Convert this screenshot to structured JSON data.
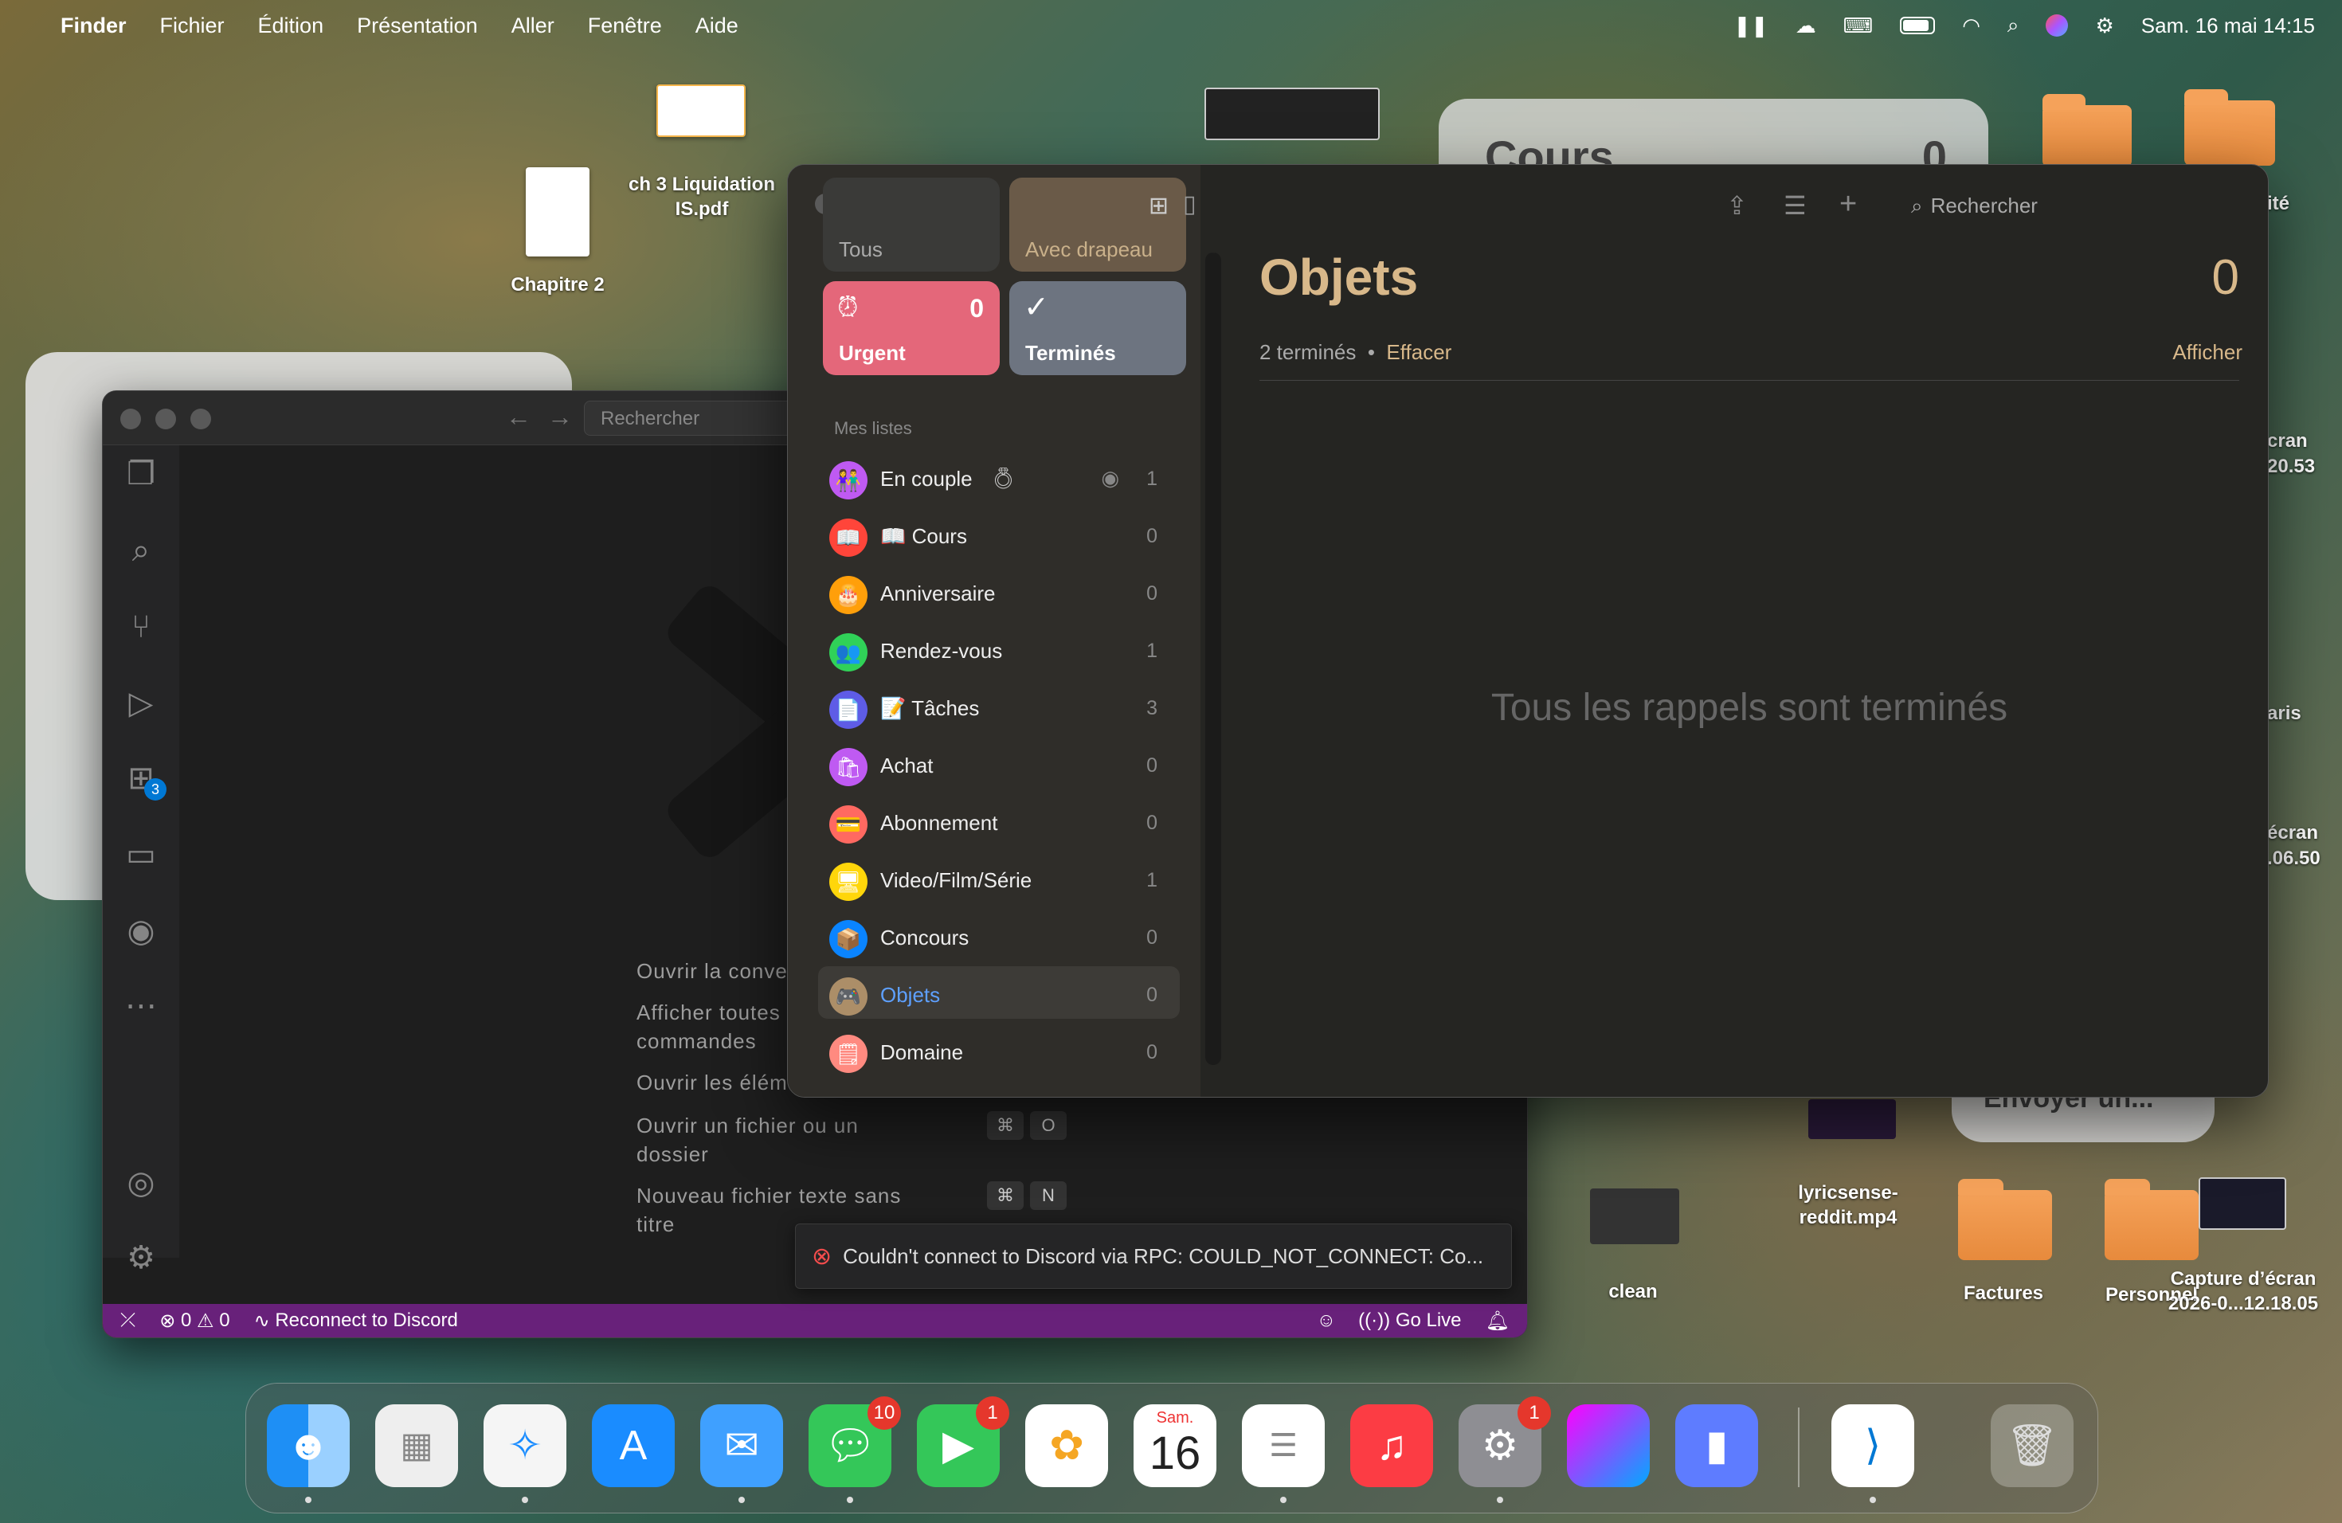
{
  "menubar": {
    "app": "Finder",
    "items": [
      "Fichier",
      "Édition",
      "Présentation",
      "Aller",
      "Fenêtre",
      "Aide"
    ],
    "clock": "Sam. 16 mai  14:15"
  },
  "desktop": {
    "files": [
      {
        "label": "ch 3 Liquidation IS.pdf"
      },
      {
        "label": "Chapitre 2"
      }
    ],
    "right_labels": [
      "ité",
      "cran",
      "20.53",
      "aris",
      "écran",
      ".06.50"
    ],
    "bottom": [
      "clean",
      "lyricsense-reddit.mp4",
      "Factures",
      "Personnel",
      "Capture d’écran 2026-0...12.18.05"
    ],
    "widget_title": "Cours",
    "widget_count": "0",
    "widget_bottom": "Envoyer un..."
  },
  "vscode": {
    "search_placeholder": "Rechercher",
    "extensions_badge": "3",
    "shortcuts": [
      {
        "text": "Ouvrir la conve"
      },
      {
        "text": "Afficher toutes"
      },
      {
        "text": "commandes"
      },
      {
        "text": "Ouvrir les éléme"
      },
      {
        "text": "Ouvrir un fichier ou un"
      },
      {
        "text": "dossier"
      },
      {
        "text": "Nouveau fichier texte sans"
      },
      {
        "text": "titre"
      }
    ],
    "keys": [
      "⌘",
      "O",
      "⌘",
      "N"
    ],
    "notification": "Couldn't connect to Discord via RPC: COULD_NOT_CONNECT: Co...",
    "status": {
      "errors": "0",
      "warnings": "0",
      "discord": "Reconnect to Discord",
      "golive": "Go Live"
    }
  },
  "reminders": {
    "tiles": {
      "all": "Tous",
      "flagged": "Avec drapeau",
      "urgent": "Urgent",
      "urgent_count": "0",
      "done": "Terminés"
    },
    "section": "Mes listes",
    "lists": [
      {
        "name": "En couple",
        "count": "1",
        "color": "#bf5af2",
        "icon": "👫"
      },
      {
        "name": "📖 Cours",
        "count": "0",
        "color": "#ff453a",
        "icon": "📖"
      },
      {
        "name": "Anniversaire",
        "count": "0",
        "color": "#ff9f0a",
        "icon": "🎂"
      },
      {
        "name": "Rendez-vous",
        "count": "1",
        "color": "#30d158",
        "icon": "👥"
      },
      {
        "name": "📝 Tâches",
        "count": "3",
        "color": "#5e5ce6",
        "icon": "📄"
      },
      {
        "name": "Achat",
        "count": "0",
        "color": "#bf5af2",
        "icon": "🛍"
      },
      {
        "name": "Abonnement",
        "count": "0",
        "color": "#ff6961",
        "icon": "💳"
      },
      {
        "name": "Video/Film/Série",
        "count": "1",
        "color": "#ffd60a",
        "icon": "🖥"
      },
      {
        "name": "Concours",
        "count": "0",
        "color": "#0a84ff",
        "icon": "📦"
      },
      {
        "name": "Objets",
        "count": "0",
        "color": "#ac8e68",
        "icon": "🎮",
        "selected": true
      },
      {
        "name": "Domaine",
        "count": "0",
        "color": "#ff6961",
        "icon": "🗒"
      }
    ],
    "main": {
      "title": "Objets",
      "count": "0",
      "done_text": "2 terminés",
      "clear": "Effacer",
      "show": "Afficher",
      "empty": "Tous les rappels sont terminés",
      "search": "Rechercher"
    },
    "accent": "#d8b88a"
  },
  "dock": {
    "messages_badge": "10",
    "facetime_badge": "1",
    "settings_badge": "1",
    "calendar_day": "16",
    "calendar_month": "Sam."
  }
}
